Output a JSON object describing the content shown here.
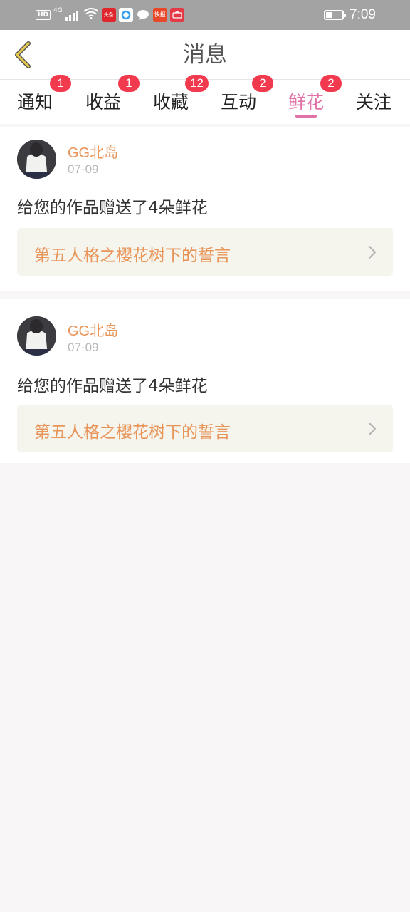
{
  "status_bar": {
    "hd": "HD",
    "network": "4G",
    "apps": [
      {
        "name": "toutiao-icon",
        "label": "头条",
        "color": "#e0262d"
      },
      {
        "name": "browser-icon",
        "label": "",
        "color": "#3aa0f0"
      },
      {
        "name": "message-icon",
        "label": "",
        "color": "#a3a3a3"
      },
      {
        "name": "kuaibao-icon",
        "label": "快报",
        "color": "#e8472a"
      },
      {
        "name": "huawei-icon",
        "label": "",
        "color": "#e53946"
      }
    ],
    "battery_level": 0.35,
    "time": "7:09"
  },
  "header": {
    "title": "消息",
    "back_icon": "chevron-left-icon",
    "back_color": "#e6c94b"
  },
  "tabs": [
    {
      "id": "notice",
      "label": "通知",
      "badge": "1",
      "active": false
    },
    {
      "id": "earnings",
      "label": "收益",
      "badge": "1",
      "active": false
    },
    {
      "id": "favorites",
      "label": "收藏",
      "badge": "12",
      "active": false
    },
    {
      "id": "interaction",
      "label": "互动",
      "badge": "2",
      "active": false
    },
    {
      "id": "flowers",
      "label": "鲜花",
      "badge": "2",
      "active": true
    },
    {
      "id": "follow",
      "label": "关注",
      "badge": "",
      "active": false
    }
  ],
  "colors": {
    "accent": "#e072a8",
    "badge": "#f23a4f",
    "username": "#e8955a",
    "link_bg": "#f5f5ee"
  },
  "messages": [
    {
      "user": "GG北岛",
      "date": "07-09",
      "text": "给您的作品赠送了4朵鲜花",
      "work_title": "第五人格之樱花树下的誓言"
    },
    {
      "user": "GG北岛",
      "date": "07-09",
      "text": "给您的作品赠送了4朵鲜花",
      "work_title": "第五人格之樱花树下的誓言"
    }
  ]
}
